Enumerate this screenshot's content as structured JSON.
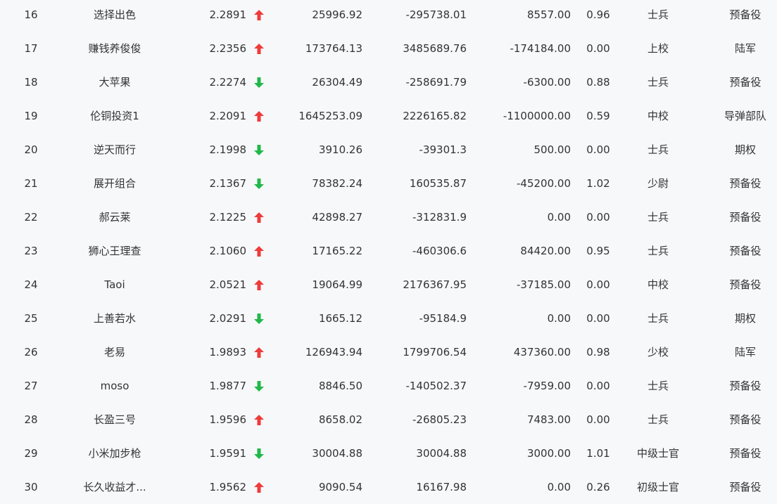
{
  "colors": {
    "up": "#ee3b3b",
    "down": "#21b84a",
    "background": "#f7f8fa",
    "text": "#333333"
  },
  "rows": [
    {
      "rank": "16",
      "name": "选择出色",
      "score": "2.2891",
      "trend": "up",
      "trend_icon": "arrow-up-icon",
      "v1": "25996.92",
      "v2": "-295738.01",
      "v3": "8557.00",
      "ratio": "0.96",
      "level": "士兵",
      "category": "预备役"
    },
    {
      "rank": "17",
      "name": "赚钱养俊俊",
      "score": "2.2356",
      "trend": "up",
      "trend_icon": "arrow-up-icon",
      "v1": "173764.13",
      "v2": "3485689.76",
      "v3": "-174184.00",
      "ratio": "0.00",
      "level": "上校",
      "category": "陆军"
    },
    {
      "rank": "18",
      "name": "大苹果",
      "score": "2.2274",
      "trend": "down",
      "trend_icon": "arrow-down-icon",
      "v1": "26304.49",
      "v2": "-258691.79",
      "v3": "-6300.00",
      "ratio": "0.88",
      "level": "士兵",
      "category": "预备役"
    },
    {
      "rank": "19",
      "name": "伦铜投资1",
      "score": "2.2091",
      "trend": "up",
      "trend_icon": "arrow-up-icon",
      "v1": "1645253.09",
      "v2": "2226165.82",
      "v3": "-1100000.00",
      "ratio": "0.59",
      "level": "中校",
      "category": "导弹部队"
    },
    {
      "rank": "20",
      "name": "逆天而行",
      "score": "2.1998",
      "trend": "down",
      "trend_icon": "arrow-down-icon",
      "v1": "3910.26",
      "v2": "-39301.3",
      "v3": "500.00",
      "ratio": "0.00",
      "level": "士兵",
      "category": "期权"
    },
    {
      "rank": "21",
      "name": "展开组合",
      "score": "2.1367",
      "trend": "down",
      "trend_icon": "arrow-down-icon",
      "v1": "78382.24",
      "v2": "160535.87",
      "v3": "-45200.00",
      "ratio": "1.02",
      "level": "少尉",
      "category": "预备役"
    },
    {
      "rank": "22",
      "name": "郝云莱",
      "score": "2.1225",
      "trend": "up",
      "trend_icon": "arrow-up-icon",
      "v1": "42898.27",
      "v2": "-312831.9",
      "v3": "0.00",
      "ratio": "0.00",
      "level": "士兵",
      "category": "预备役"
    },
    {
      "rank": "23",
      "name": "狮心王理查",
      "score": "2.1060",
      "trend": "up",
      "trend_icon": "arrow-up-icon",
      "v1": "17165.22",
      "v2": "-460306.6",
      "v3": "84420.00",
      "ratio": "0.95",
      "level": "士兵",
      "category": "预备役"
    },
    {
      "rank": "24",
      "name": "Taoi",
      "score": "2.0521",
      "trend": "up",
      "trend_icon": "arrow-up-icon",
      "v1": "19064.99",
      "v2": "2176367.95",
      "v3": "-37185.00",
      "ratio": "0.00",
      "level": "中校",
      "category": "预备役"
    },
    {
      "rank": "25",
      "name": "上善若水",
      "score": "2.0291",
      "trend": "down",
      "trend_icon": "arrow-down-icon",
      "v1": "1665.12",
      "v2": "-95184.9",
      "v3": "0.00",
      "ratio": "0.00",
      "level": "士兵",
      "category": "期权"
    },
    {
      "rank": "26",
      "name": "老易",
      "score": "1.9893",
      "trend": "up",
      "trend_icon": "arrow-up-icon",
      "v1": "126943.94",
      "v2": "1799706.54",
      "v3": "437360.00",
      "ratio": "0.98",
      "level": "少校",
      "category": "陆军"
    },
    {
      "rank": "27",
      "name": "moso",
      "score": "1.9877",
      "trend": "down",
      "trend_icon": "arrow-down-icon",
      "v1": "8846.50",
      "v2": "-140502.37",
      "v3": "-7959.00",
      "ratio": "0.00",
      "level": "士兵",
      "category": "预备役"
    },
    {
      "rank": "28",
      "name": "长盈三号",
      "score": "1.9596",
      "trend": "up",
      "trend_icon": "arrow-up-icon",
      "v1": "8658.02",
      "v2": "-26805.23",
      "v3": "7483.00",
      "ratio": "0.00",
      "level": "士兵",
      "category": "预备役"
    },
    {
      "rank": "29",
      "name": "小米加步枪",
      "score": "1.9591",
      "trend": "down",
      "trend_icon": "arrow-down-icon",
      "v1": "30004.88",
      "v2": "30004.88",
      "v3": "3000.00",
      "ratio": "1.01",
      "level": "中级士官",
      "category": "预备役"
    },
    {
      "rank": "30",
      "name": "长久收益才...",
      "score": "1.9562",
      "trend": "up",
      "trend_icon": "arrow-up-icon",
      "v1": "9090.54",
      "v2": "16167.98",
      "v3": "0.00",
      "ratio": "0.26",
      "level": "初级士官",
      "category": "预备役"
    }
  ]
}
